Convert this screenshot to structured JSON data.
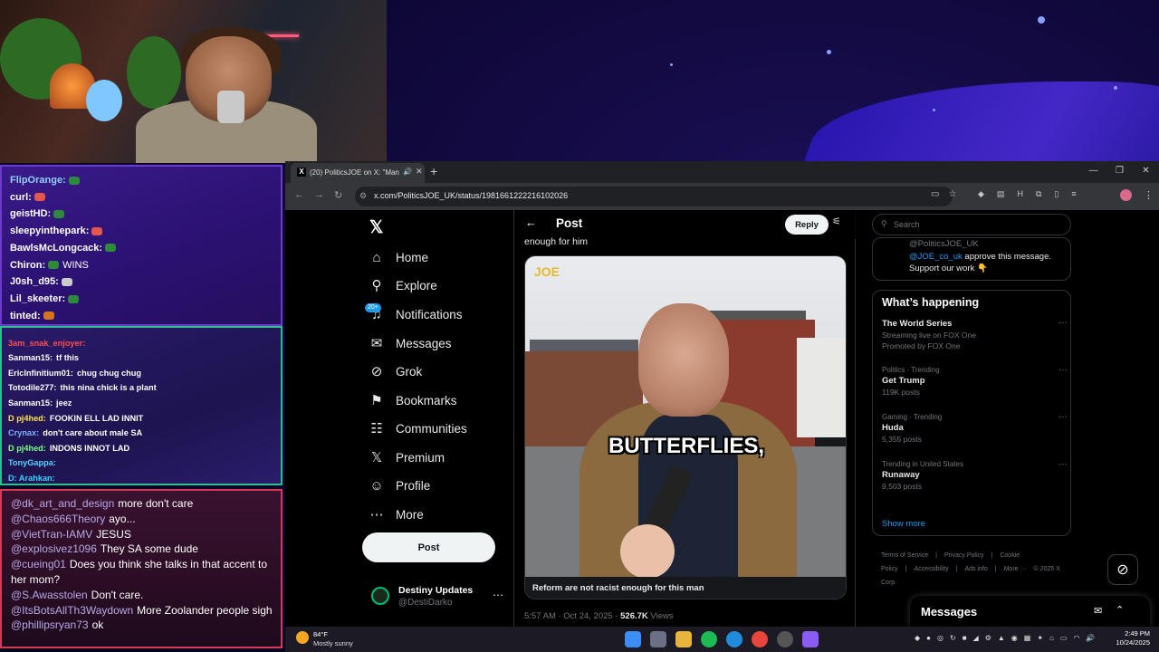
{
  "chat_primary": [
    {
      "name": "FlipOrange:",
      "color": "#8fd0ff",
      "text": ""
    },
    {
      "name": "curl:",
      "color": "#ffffff",
      "text": ""
    },
    {
      "name": "geistHD:",
      "color": "#ffffff",
      "text": ""
    },
    {
      "name": "sleepyinthepark:",
      "color": "#ffffff",
      "text": ""
    },
    {
      "name": "BawlsMcLongcack:",
      "color": "#ffffff",
      "text": ""
    },
    {
      "name": "Chiron:",
      "color": "#ffffff",
      "text": "WINS"
    },
    {
      "name": "J0sh_d95:",
      "color": "#ffffff",
      "text": ""
    },
    {
      "name": "Lil_skeeter:",
      "color": "#ffffff",
      "text": ""
    },
    {
      "name": "tinted:",
      "color": "#ffffff",
      "text": ""
    }
  ],
  "chat_secondary": [
    {
      "name": "",
      "color": "#f5f5f5",
      "text": ""
    },
    {
      "name": "3am_snak_enjoyer:",
      "color": "#ff4d4d",
      "text": ""
    },
    {
      "name": "Sanman15:",
      "color": "#ffffff",
      "text": "tf this"
    },
    {
      "name": "EricInfinitium01:",
      "color": "#ffffff",
      "text": "chug chug chug"
    },
    {
      "name": "Totodile277:",
      "color": "#ffffff",
      "text": "this nina chick is a plant"
    },
    {
      "name": "Sanman15:",
      "color": "#ffffff",
      "text": "jeez"
    },
    {
      "name": "D pj4hed:",
      "color": "#ffe14d",
      "text": "FOOKIN ELL LAD INNIT"
    },
    {
      "name": "Crynax:",
      "color": "#7fb0ff",
      "text": "don't care about male SA"
    },
    {
      "name": "D pj4hed:",
      "color": "#7dff7d",
      "text": "INDONS INNOT LAD"
    },
    {
      "name": "TonyGappa:",
      "color": "#5ad1ff",
      "text": ""
    },
    {
      "name": "D: Arahkan:",
      "color": "#3ad1ff",
      "text": ""
    }
  ],
  "chat_tertiary": [
    {
      "name": "@dk_art_and_design",
      "text": "more don't care"
    },
    {
      "name": "@Chaos666Theory",
      "text": "ayo..."
    },
    {
      "name": "@VietTran-IAMV",
      "text": "JESUS"
    },
    {
      "name": "@explosivez1096",
      "text": "They SA some dude"
    },
    {
      "name": "@cueing01",
      "text": "Does you think she talks in that accent to her mom?"
    },
    {
      "name": "@S.Awasstolen",
      "text": "Don't care."
    },
    {
      "name": "@ItsBotsAllTh3Waydown",
      "text": "More Zoolander people sigh"
    },
    {
      "name": "@phillipsryan73",
      "text": "ok"
    }
  ],
  "browser": {
    "tab_title": "(20) PoliticsJOE on X: \"Man",
    "url": "x.com/PoliticsJOE_UK/status/1981661222216102026"
  },
  "x": {
    "nav": [
      {
        "icon": "home-icon",
        "glyph": "⌂",
        "label": "Home"
      },
      {
        "icon": "search-icon",
        "glyph": "⚲",
        "label": "Explore"
      },
      {
        "icon": "bell-icon",
        "glyph": "♫",
        "label": "Notifications"
      },
      {
        "icon": "mail-icon",
        "glyph": "✉",
        "label": "Messages"
      },
      {
        "icon": "grok-icon",
        "glyph": "⊘",
        "label": "Grok"
      },
      {
        "icon": "bookmark-icon",
        "glyph": "⚑",
        "label": "Bookmarks"
      },
      {
        "icon": "communities-icon",
        "glyph": "☷",
        "label": "Communities"
      },
      {
        "icon": "x-premium-icon",
        "glyph": "𝕏",
        "label": "Premium"
      },
      {
        "icon": "profile-icon",
        "glyph": "☺",
        "label": "Profile"
      },
      {
        "icon": "more-icon",
        "glyph": "⋯",
        "label": "More"
      }
    ],
    "notif_badge": "20+",
    "post_button": "Post",
    "account": {
      "name": "Destiny Updates",
      "handle": "@DestiDarko"
    },
    "header_title": "Post",
    "reply_button": "Reply",
    "tweet_text_partial": "enough for him",
    "media_logo": "JOE",
    "media_caption": "BUTTERFLIES,",
    "media_footer": "Reform are not racist enough for this man",
    "tweet_time": "5:57 AM · Oct 24, 2025 ·",
    "tweet_views": "526.7K",
    "tweet_views_label": "Views",
    "search_placeholder": "Search",
    "subscribe_handle": "@PoliticsJOE_UK",
    "subscribe_link": "@JOE_co_uk",
    "subscribe_msg": "approve this message. Support our work 👇",
    "trends_title": "What’s happening",
    "trends": [
      {
        "context": "",
        "name": "The World Series",
        "detail": "Streaming live on FOX One",
        "extra": "Promoted by FOX One"
      },
      {
        "context": "Politics · Trending",
        "name": "Get Trump",
        "detail": "119K posts",
        "extra": ""
      },
      {
        "context": "Gaming · Trending",
        "name": "Huda",
        "detail": "5,355 posts",
        "extra": ""
      },
      {
        "context": "Trending in United States",
        "name": "Runaway",
        "detail": "9,503 posts",
        "extra": ""
      }
    ],
    "show_more": "Show more",
    "footer_links": [
      "Terms of Service",
      "|",
      "Privacy Policy",
      "|",
      "Cookie Policy",
      "|",
      "Accessibility",
      "|",
      "Ads info",
      "|",
      "More ···",
      "© 2025 X Corp."
    ],
    "messages_drawer": "Messages"
  },
  "taskbar": {
    "temp": "84°F",
    "condition": "Mostly sunny",
    "time": "2:49 PM",
    "date": "10/24/2025"
  }
}
